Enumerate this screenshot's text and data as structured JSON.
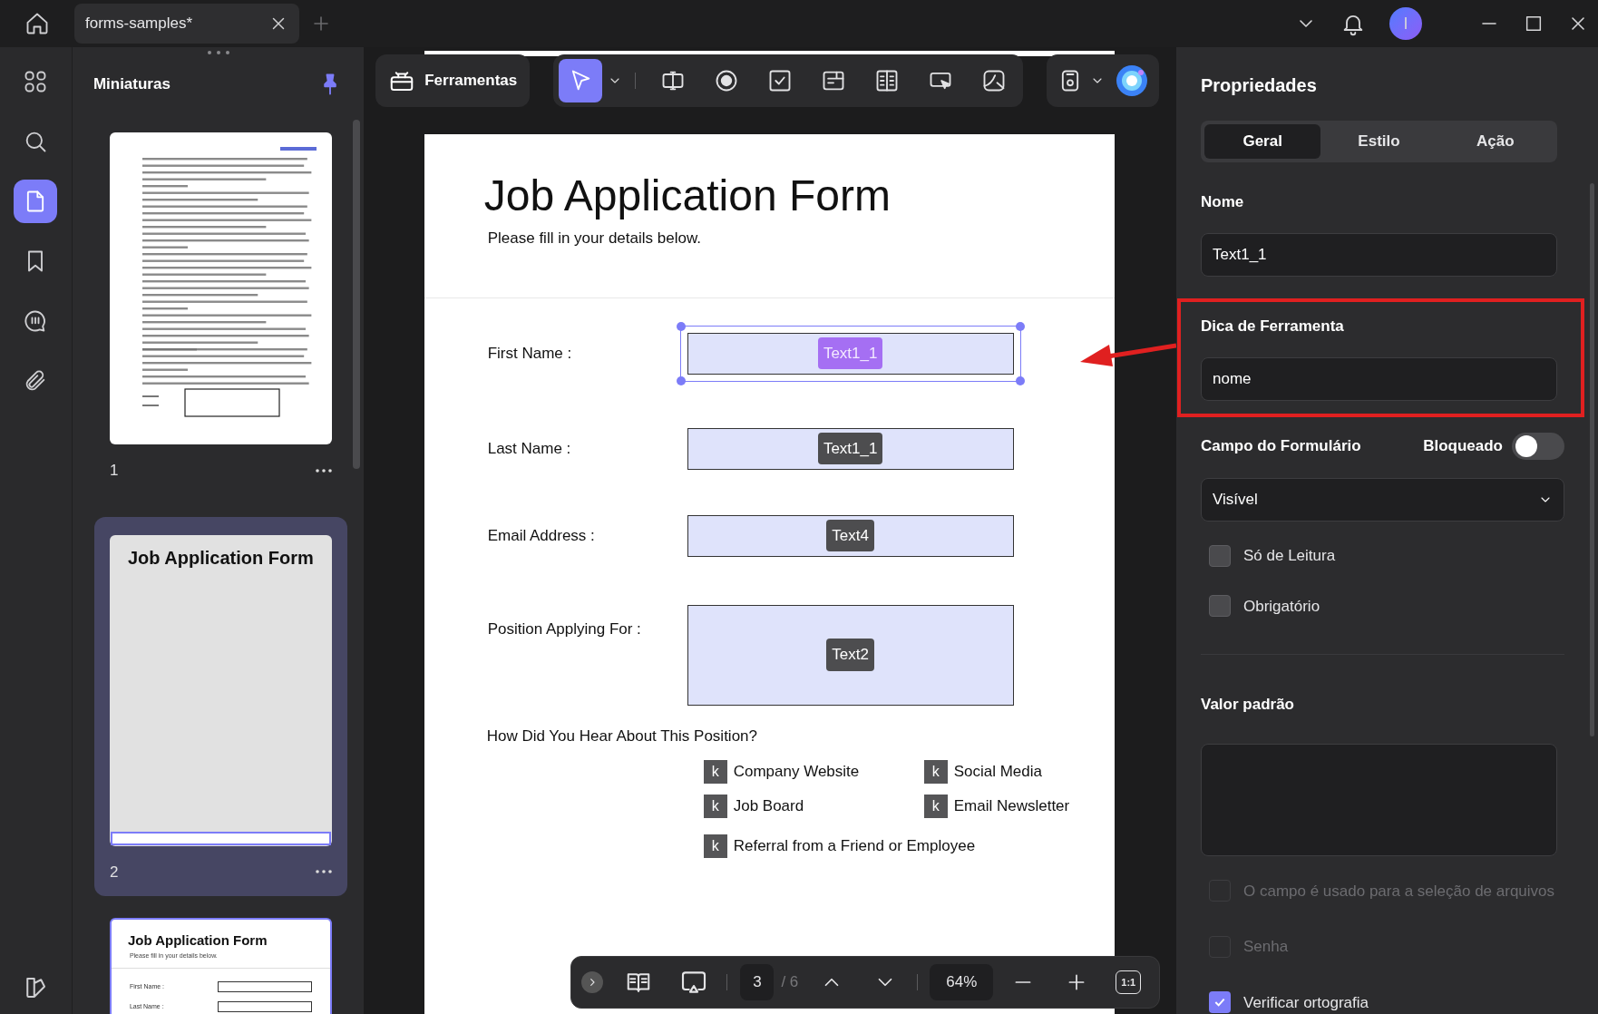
{
  "tabs": [
    {
      "label": "forms-samples*",
      "selected": true
    }
  ],
  "avatar": {
    "initial": "I"
  },
  "rail": [
    {
      "kind": "grid",
      "selected": false
    },
    {
      "kind": "search",
      "selected": false
    },
    {
      "kind": "page",
      "selected": true
    },
    {
      "kind": "bookmark",
      "selected": false
    },
    {
      "kind": "comment",
      "selected": false
    },
    {
      "kind": "attachment",
      "selected": false
    }
  ],
  "thumbnails": {
    "title": "Miniaturas",
    "pages": [
      {
        "kind": "document",
        "number": "1",
        "selected": false
      },
      {
        "kind": "title",
        "number": "2",
        "selected": true,
        "title": "Job Application Form"
      },
      {
        "kind": "form",
        "selected": false,
        "title": "Job Application Form",
        "subtitle": "Please fill in your details below.",
        "fields": [
          "First Name :",
          "Last Name :"
        ]
      }
    ]
  },
  "toolbar": {
    "tools_label": "Ferramentas",
    "tools": [
      {
        "kind": "select",
        "selected": true
      },
      {
        "kind": "text",
        "selected": false
      },
      {
        "kind": "radio",
        "selected": false
      },
      {
        "kind": "checkbox",
        "selected": false
      },
      {
        "kind": "combo",
        "selected": false
      },
      {
        "kind": "list",
        "selected": false
      },
      {
        "kind": "button",
        "selected": false
      },
      {
        "kind": "image",
        "selected": false
      }
    ]
  },
  "document": {
    "title": "Job Application Form",
    "subtitle": "Please fill in your details below.",
    "fields": [
      {
        "label": "First Name :",
        "field_name": "Text1_1",
        "selected": true,
        "tall": false
      },
      {
        "label": "Last Name :",
        "field_name": "Text1_1",
        "selected": false,
        "tall": false
      },
      {
        "label": "Email Address :",
        "field_name": "Text4",
        "selected": false,
        "tall": false
      },
      {
        "label": "Position Applying For :",
        "field_name": "Text2",
        "selected": false,
        "tall": true
      }
    ],
    "question": "How Did You Hear About This Position?",
    "options": [
      {
        "label": "Company Website",
        "box_text": "k"
      },
      {
        "label": "Social Media",
        "box_text": "k"
      },
      {
        "label": "Job Board",
        "box_text": "k"
      },
      {
        "label": "Email Newsletter",
        "box_text": "k"
      },
      {
        "label": "Referral from a Friend or Employee",
        "box_text": "k"
      }
    ]
  },
  "page_nav": {
    "page": "3",
    "total": "/ 6",
    "zoom": "64%",
    "zoom_reset": "1:1"
  },
  "properties": {
    "title": "Propriedades",
    "tabs": [
      {
        "label": "Geral",
        "selected": true
      },
      {
        "label": "Estilo",
        "selected": false
      },
      {
        "label": "Ação",
        "selected": false
      }
    ],
    "name_label": "Nome",
    "name_value": "Text1_1",
    "tooltip_label": "Dica de Ferramenta",
    "tooltip_value": "nome",
    "form_field_label": "Campo do Formulário",
    "locked_label": "Bloqueado",
    "locked": false,
    "visibility": "Visível",
    "checks": [
      {
        "label": "Só de Leitura",
        "checked": false,
        "disabled": false
      },
      {
        "label": "Obrigatório",
        "checked": false,
        "disabled": false
      }
    ],
    "default_label": "Valor padrão",
    "more_checks": [
      {
        "label": "O campo é usado para a seleção de arquivos",
        "checked": false,
        "disabled": true
      },
      {
        "label": "Senha",
        "checked": false,
        "disabled": true
      },
      {
        "label": "Verificar ortografia",
        "checked": true,
        "disabled": false
      }
    ]
  },
  "annotations": {
    "arrow": true,
    "frame": true
  }
}
